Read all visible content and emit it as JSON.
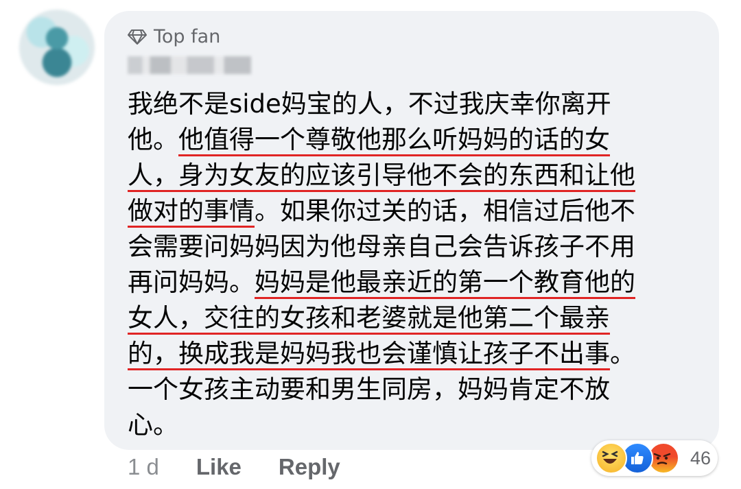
{
  "comment": {
    "badge": "Top fan",
    "lines": [
      [
        {
          "t": "我绝不是side妈宝的人，不过我庆幸你离开",
          "u": false
        }
      ],
      [
        {
          "t": "他。",
          "u": false
        },
        {
          "t": "他值得一个尊敬他那么听妈妈的话的女",
          "u": true
        }
      ],
      [
        {
          "t": "人，身为女友的应该引导他不会的东西和让他",
          "u": true
        }
      ],
      [
        {
          "t": "做对的事情",
          "u": true
        },
        {
          "t": "。如果你过关的话，相信过后他不",
          "u": false
        }
      ],
      [
        {
          "t": "会需要问妈妈因为他母亲自己会告诉孩子不用",
          "u": false
        }
      ],
      [
        {
          "t": "再问妈妈。",
          "u": false
        },
        {
          "t": "妈妈是他最亲近的第一个教育他的",
          "u": true
        }
      ],
      [
        {
          "t": "女人，交往的女孩和老婆就是他第二个最亲",
          "u": true
        }
      ],
      [
        {
          "t": "的，换成我是妈妈我也会谨慎让孩子不出事",
          "u": true
        },
        {
          "t": "。",
          "u": false
        }
      ],
      [
        {
          "t": "一个女孩主动要和男生同房，妈妈肯定不放",
          "u": false
        }
      ],
      [
        {
          "t": "心。",
          "u": false
        }
      ]
    ]
  },
  "actions": {
    "time": "1 d",
    "like_label": "Like",
    "reply_label": "Reply"
  },
  "reactions": {
    "icons": [
      "haha-icon",
      "like-icon",
      "angry-icon"
    ],
    "count": "46"
  },
  "colors": {
    "bubble": "#f0f2f5",
    "underline": "#e02424",
    "meta": "#65676b"
  }
}
